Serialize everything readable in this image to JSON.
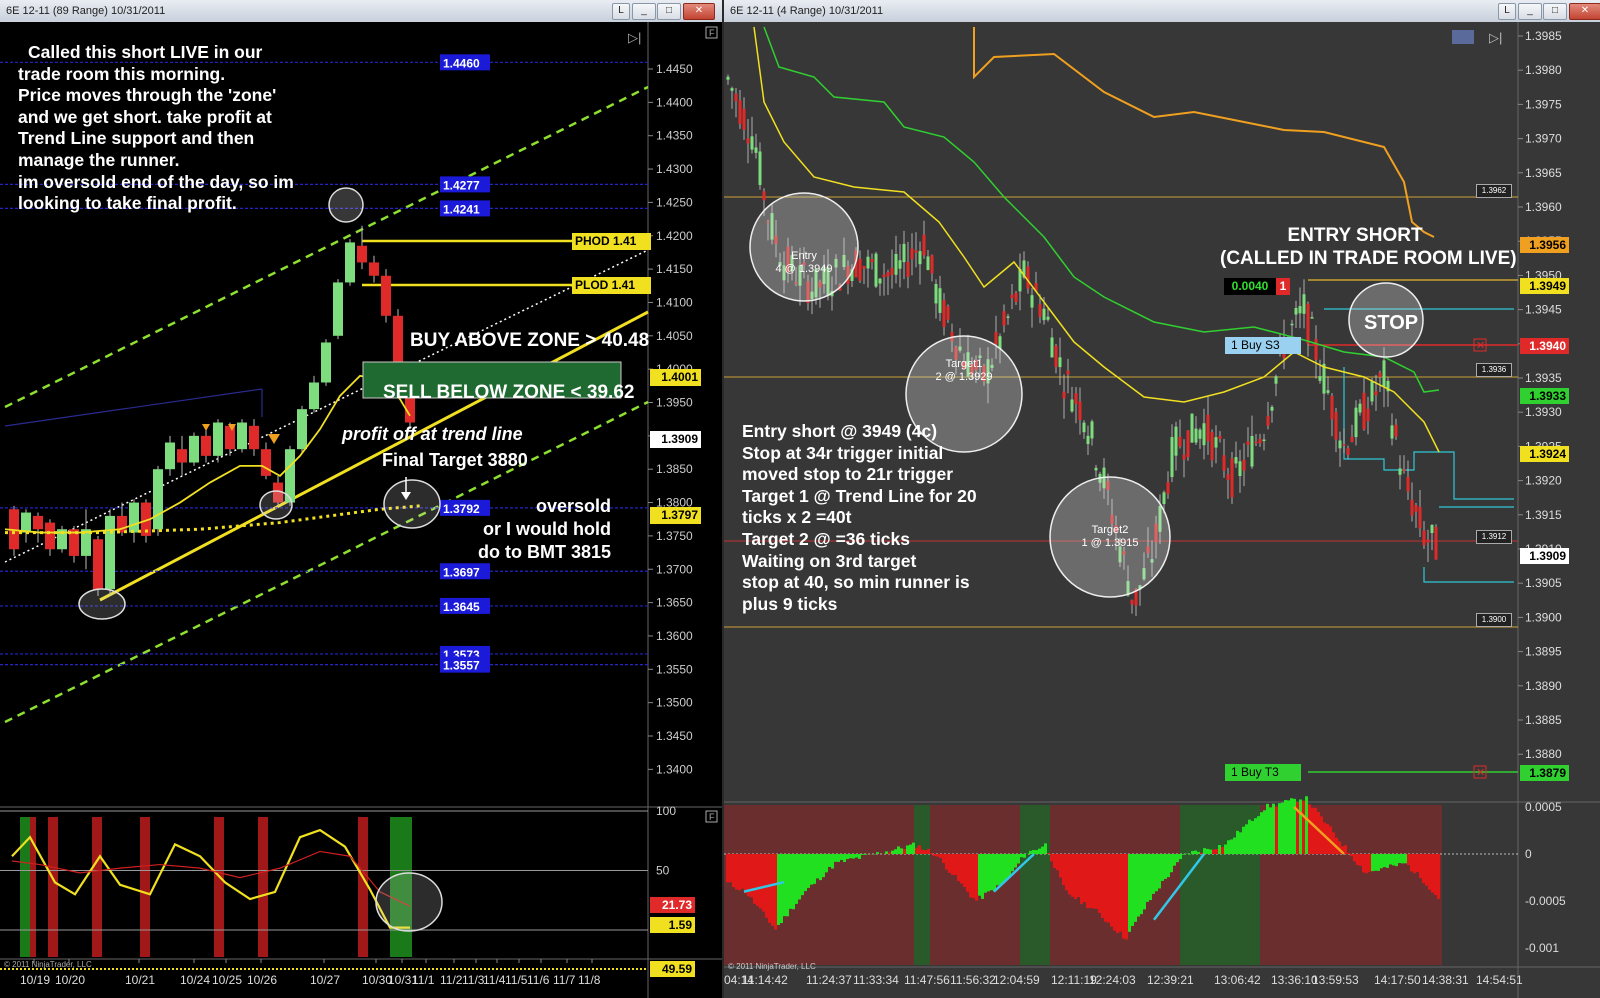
{
  "left_window": {
    "title": "6E 12-11 (89 Range)  10/31/2011",
    "buttons": {
      "minimize": "_",
      "restore": "□",
      "close": "✕",
      "small": "L"
    },
    "annotation_main": [
      "Called this short LIVE in our",
      "trade room this morning.",
      "Price moves through the 'zone'",
      "and we get short. take profit at",
      "Trend Line support and then",
      "manage the runner.",
      "im oversold end of the day, so im",
      "looking to take final profit."
    ],
    "buy_above_zone": "BUY ABOVE ZONE > 40.48",
    "sell_below_zone": "SELL BELOW ZONE < 39.62",
    "profit_off": "profit off at trend line",
    "final_target": "Final Target 3880",
    "oversold_note": [
      "oversold",
      "or I would hold",
      "do to BMT 3815"
    ],
    "phod_label": "PHOD 1.41",
    "plod_label": "PLOD 1.41",
    "level_labels": [
      "1.4460",
      "1.4277",
      "1.4241",
      "1.3792",
      "1.3697",
      "1.3645",
      "1.3573",
      "1.3557"
    ],
    "price_axis": [
      "1.4450",
      "1.4400",
      "1.4350",
      "1.4300",
      "1.4250",
      "1.4200",
      "1.4150",
      "1.4100",
      "1.4050",
      "1.4000",
      "1.3950",
      "1.3900",
      "1.3850",
      "1.3800",
      "1.3750",
      "1.3700",
      "1.3650",
      "1.3600",
      "1.3550",
      "1.3500",
      "1.3450",
      "1.3400"
    ],
    "price_tags": {
      "current": "1.4001",
      "alt": "1.3909",
      "ma": "1.3797"
    },
    "osc_axis": [
      "100",
      "50"
    ],
    "osc_tags": [
      "21.73",
      "1.59",
      "49.59"
    ],
    "date_axis": [
      "10/19",
      "10/20",
      "10/21",
      "10/24",
      "10/25",
      "10/26",
      "10/27",
      "10/30",
      "10/31",
      "11/1",
      "11/2",
      "11/3",
      "11/4",
      "11/5",
      "11/6",
      "11/7",
      "11/8"
    ],
    "copyright": "© 2011 NinjaTrader, LLC"
  },
  "right_window": {
    "title": "6E 12-11 (4 Range)  10/31/2011",
    "buttons": {
      "minimize": "_",
      "restore": "□",
      "close": "✕",
      "small": "L"
    },
    "entry_short": [
      "ENTRY SHORT",
      "(CALLED IN TRADE ROOM LIVE)"
    ],
    "stop_label": "STOP",
    "entry_notes": [
      "Entry short @ 3949 (4c)",
      "Stop at 34r trigger initial",
      "moved stop to 21r trigger",
      "Target 1 @ Trend Line for 20",
      "ticks x 2 =40t",
      "Target 2 @ =36 ticks",
      "Waiting on 3rd target",
      "stop at 40, so min runner is",
      "plus 9 ticks"
    ],
    "circle_entry": [
      "Entry",
      "4 @ 1.3949"
    ],
    "circle_target1": [
      "Target1",
      "2 @ 1.3929"
    ],
    "circle_target2": [
      "Target2",
      "1 @ 1.3915"
    ],
    "pnl": "0.0040",
    "pnl_qty": "1",
    "buy_s3": "1  Buy S3",
    "buy_t3": "1  Buy T3",
    "price_axis": [
      "1.3985",
      "1.3980",
      "1.3975",
      "1.3970",
      "1.3965",
      "1.3960",
      "1.3955",
      "1.3950",
      "1.3945",
      "1.3940",
      "1.3935",
      "1.3930",
      "1.3925",
      "1.3920",
      "1.3915",
      "1.3910",
      "1.3905",
      "1.3900",
      "1.3895",
      "1.3890",
      "1.3885",
      "1.3880"
    ],
    "price_tags": {
      "t1": "1.3956",
      "t2": "1.3949",
      "stop": "1.3940",
      "t3": "1.3933",
      "t4": "1.3924",
      "cur": "1.3909",
      "tgt": "1.3879"
    },
    "small_tags": [
      "1.3962",
      "1.3936",
      "1.3912",
      "1.3900"
    ],
    "osc_axis": [
      "0.0005",
      "0",
      "-0.0005",
      "-0.001"
    ],
    "time_axis": [
      "04:14",
      "11:14:42",
      "11:24:37",
      "11:33:34",
      "11:47:56",
      "11:56:32",
      "12:04:59",
      "12:11:19",
      "12:24:03",
      "12:39:21",
      "13:06:42",
      "13:36:10",
      "13:59:53",
      "14:17:50",
      "14:38:31",
      "14:54:51"
    ],
    "copyright": "© 2011 NinjaTrader, LLC"
  },
  "colors": {
    "up": "#7ddc7d",
    "down": "#e02a2a",
    "yellow": "#f0e020",
    "blue_tag": "#1a1ad8",
    "green_dash": "#8ee030",
    "orange": "#f0a020",
    "green_line": "#30d030"
  }
}
